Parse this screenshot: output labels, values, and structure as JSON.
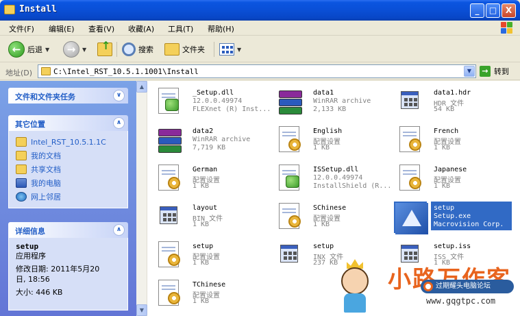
{
  "window": {
    "title": "Install",
    "min_label": "_",
    "max_label": "□",
    "close_label": "X"
  },
  "menu": {
    "items": [
      "文件(F)",
      "编辑(E)",
      "查看(V)",
      "收藏(A)",
      "工具(T)",
      "帮助(H)"
    ]
  },
  "toolbar": {
    "back_label": "后退",
    "search_label": "搜索",
    "folders_label": "文件夹"
  },
  "address": {
    "label": "地址(D)",
    "path": "C:\\Intel_RST_10.5.1.1001\\Install",
    "go_label": "转到"
  },
  "left_pane": {
    "tasks_title": "文件和文件夹任务",
    "places_title": "其它位置",
    "places": [
      {
        "label": "Intel_RST_10.5.1.1C",
        "icon": "folder-icon"
      },
      {
        "label": "我的文档",
        "icon": "folder-icon"
      },
      {
        "label": "共享文档",
        "icon": "folder-icon"
      },
      {
        "label": "我的电脑",
        "icon": "computer-icon"
      },
      {
        "label": "网上邻居",
        "icon": "network-icon"
      }
    ],
    "details_title": "详细信息",
    "details": {
      "name": "setup",
      "type": "应用程序",
      "modified_label": "修改日期: 2011年5月20",
      "modified_time": "日, 18:56",
      "size": "大小: 446 KB"
    }
  },
  "files": [
    {
      "name": "_Setup.dll",
      "line2": "12.0.0.49974",
      "line3": "FLEXnet (R) Inst...",
      "icon": "dll-icon"
    },
    {
      "name": "data1",
      "line2": "WinRAR archive",
      "line3": "2,133 KB",
      "icon": "winrar-icon"
    },
    {
      "name": "data1.hdr",
      "line2": "HDR 文件",
      "line3": "54 KB",
      "icon": "generic-file-icon"
    },
    {
      "name": "data2",
      "line2": "WinRAR archive",
      "line3": "7,719 KB",
      "icon": "winrar-icon"
    },
    {
      "name": "English",
      "line2": "配置设置",
      "line3": "1 KB",
      "icon": "config-file-icon"
    },
    {
      "name": "French",
      "line2": "配置设置",
      "line3": "1 KB",
      "icon": "config-file-icon"
    },
    {
      "name": "German",
      "line2": "配置设置",
      "line3": "1 KB",
      "icon": "config-file-icon"
    },
    {
      "name": "ISSetup.dll",
      "line2": "12.0.0.49974",
      "line3": "InstallShield (R...",
      "icon": "dll-icon"
    },
    {
      "name": "Japanese",
      "line2": "配置设置",
      "line3": "1 KB",
      "icon": "config-file-icon"
    },
    {
      "name": "layout",
      "line2": "BIN 文件",
      "line3": "1 KB",
      "icon": "generic-file-icon"
    },
    {
      "name": "SChinese",
      "line2": "配置设置",
      "line3": "1 KB",
      "icon": "config-file-icon"
    },
    {
      "name": "setup",
      "line2": "Setup.exe",
      "line3": "Macrovision Corp.",
      "icon": "setup-exe-icon",
      "selected": true
    },
    {
      "name": "setup",
      "line2": "配置设置",
      "line3": "1 KB",
      "icon": "config-file-icon"
    },
    {
      "name": "setup",
      "line2": "INX 文件",
      "line3": "237 KB",
      "icon": "generic-file-icon"
    },
    {
      "name": "setup.iss",
      "line2": "ISS 文件",
      "line3": "1 KB",
      "icon": "generic-file-icon"
    },
    {
      "name": "TChinese",
      "line2": "配置设置",
      "line3": "1 KB",
      "icon": "config-file-icon"
    }
  ],
  "watermark": {
    "title": "小路万作客",
    "badge": "过期耀头电脑论坛",
    "url": "www.gqgtpc.com"
  },
  "colors": {
    "title_bar": "#0a4fd6",
    "left_pane": "#6f8fe0",
    "selection": "#316ac5",
    "link": "#215dc6"
  }
}
